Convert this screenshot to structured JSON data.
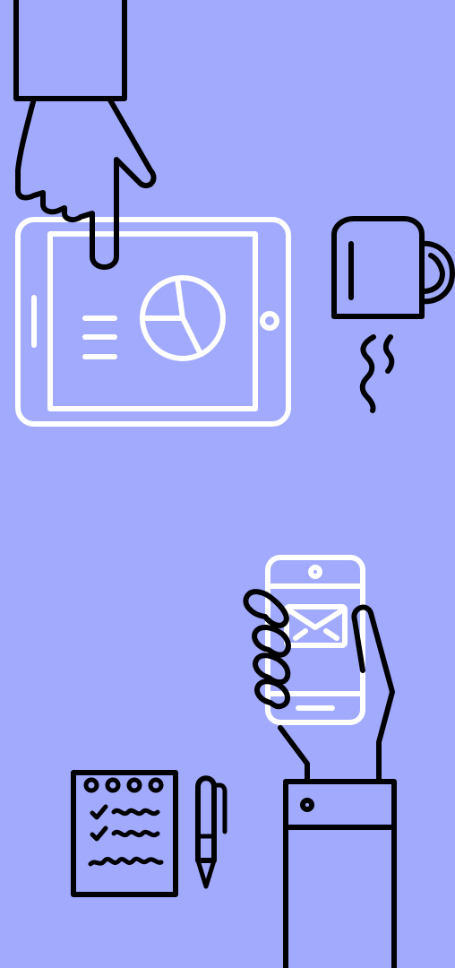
{
  "illustration": {
    "background_color": "#A2AAFE",
    "outline_color": "#000000",
    "device_color": "#FFFFFF",
    "elements": [
      "tablet-icon",
      "pie-chart-icon",
      "pointing-hand-icon",
      "coffee-mug-icon",
      "smartphone-icon",
      "envelope-icon",
      "holding-hand-icon",
      "notepad-icon",
      "pen-icon"
    ]
  }
}
